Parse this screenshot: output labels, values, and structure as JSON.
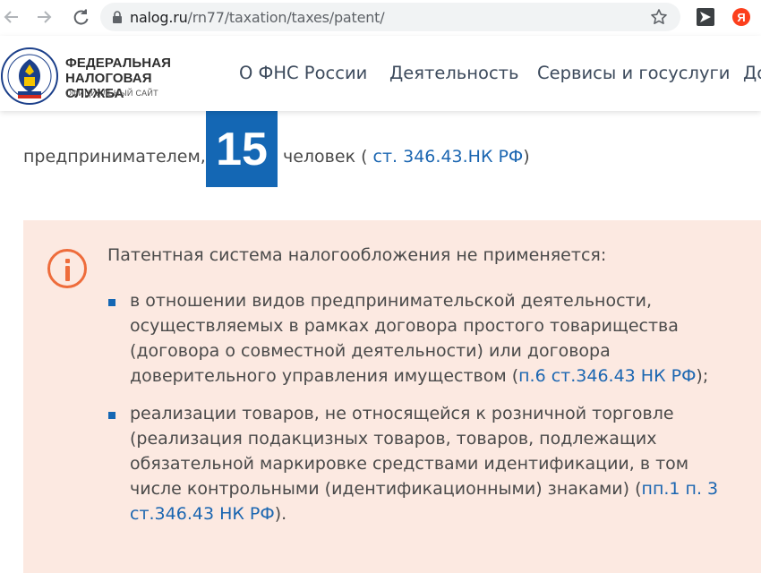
{
  "browser": {
    "url_host": "nalog.ru",
    "url_path": "/rn77/taxation/taxes/patent/"
  },
  "header": {
    "logo_title": "ФЕДЕРАЛЬНАЯ НАЛОГОВАЯ СЛУЖБА",
    "logo_subtitle": "ОФИЦИАЛЬНЫЙ САЙТ",
    "nav": [
      "О ФНС России",
      "Деятельность",
      "Сервисы и госуслуги",
      "До"
    ]
  },
  "content": {
    "intro_before": "предпринимателем,",
    "badge_number": "15",
    "intro_after": "человек (",
    "intro_link": " ст. 346.43.НК РФ",
    "intro_close": ")",
    "notice": {
      "title": "Патентная система налогообложения не применяется:",
      "item1_text": "в отношении видов предпринимательской деятельности, осуществляемых в рамках договора простого товарищества (договора о совместной деятельности) или договора доверительного управления имуществом (",
      "item1_link": "п.6 ст.346.43 НК РФ",
      "item1_end": ");",
      "item2_text": "реализации товаров, не относящейся к розничной торговле (реализация подакцизных товаров, товаров, подлежащих обязательной маркировке средствами идентификации, в том числе контрольными (идентификационными) знаками) (",
      "item2_link": "пп.1 п. 3 ст.346.43 НК РФ",
      "item2_end": ")."
    }
  },
  "colors": {
    "badge": "#1467b4",
    "notice_bg": "#fce9e1",
    "info_accent": "#ee6c3b",
    "link": "#1b66b1"
  },
  "icons": [
    "back-arrow-icon",
    "forward-arrow-icon",
    "reload-icon",
    "lock-icon",
    "star-icon",
    "extension-icon",
    "yandex-icon",
    "info-icon"
  ]
}
